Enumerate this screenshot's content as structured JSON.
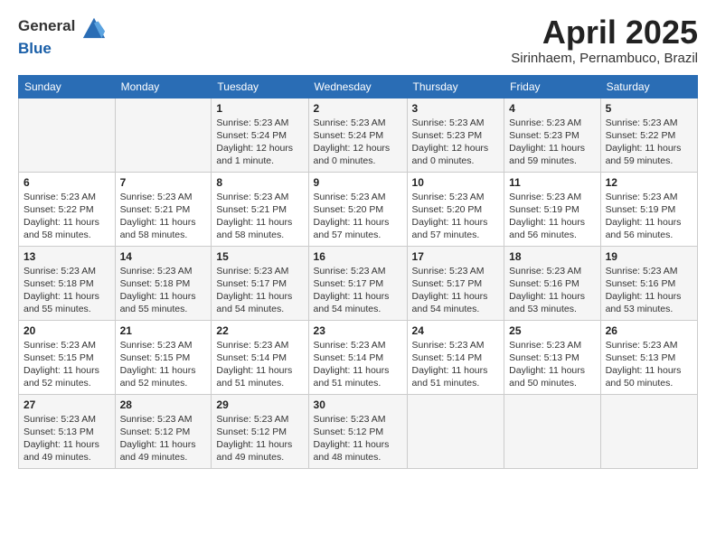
{
  "header": {
    "logo_line1": "General",
    "logo_line2": "Blue",
    "title": "April 2025",
    "subtitle": "Sirinhaem, Pernambuco, Brazil"
  },
  "days_of_week": [
    "Sunday",
    "Monday",
    "Tuesday",
    "Wednesday",
    "Thursday",
    "Friday",
    "Saturday"
  ],
  "weeks": [
    [
      {
        "day": "",
        "info": ""
      },
      {
        "day": "",
        "info": ""
      },
      {
        "day": "1",
        "info": "Sunrise: 5:23 AM\nSunset: 5:24 PM\nDaylight: 12 hours\nand 1 minute."
      },
      {
        "day": "2",
        "info": "Sunrise: 5:23 AM\nSunset: 5:24 PM\nDaylight: 12 hours\nand 0 minutes."
      },
      {
        "day": "3",
        "info": "Sunrise: 5:23 AM\nSunset: 5:23 PM\nDaylight: 12 hours\nand 0 minutes."
      },
      {
        "day": "4",
        "info": "Sunrise: 5:23 AM\nSunset: 5:23 PM\nDaylight: 11 hours\nand 59 minutes."
      },
      {
        "day": "5",
        "info": "Sunrise: 5:23 AM\nSunset: 5:22 PM\nDaylight: 11 hours\nand 59 minutes."
      }
    ],
    [
      {
        "day": "6",
        "info": "Sunrise: 5:23 AM\nSunset: 5:22 PM\nDaylight: 11 hours\nand 58 minutes."
      },
      {
        "day": "7",
        "info": "Sunrise: 5:23 AM\nSunset: 5:21 PM\nDaylight: 11 hours\nand 58 minutes."
      },
      {
        "day": "8",
        "info": "Sunrise: 5:23 AM\nSunset: 5:21 PM\nDaylight: 11 hours\nand 58 minutes."
      },
      {
        "day": "9",
        "info": "Sunrise: 5:23 AM\nSunset: 5:20 PM\nDaylight: 11 hours\nand 57 minutes."
      },
      {
        "day": "10",
        "info": "Sunrise: 5:23 AM\nSunset: 5:20 PM\nDaylight: 11 hours\nand 57 minutes."
      },
      {
        "day": "11",
        "info": "Sunrise: 5:23 AM\nSunset: 5:19 PM\nDaylight: 11 hours\nand 56 minutes."
      },
      {
        "day": "12",
        "info": "Sunrise: 5:23 AM\nSunset: 5:19 PM\nDaylight: 11 hours\nand 56 minutes."
      }
    ],
    [
      {
        "day": "13",
        "info": "Sunrise: 5:23 AM\nSunset: 5:18 PM\nDaylight: 11 hours\nand 55 minutes."
      },
      {
        "day": "14",
        "info": "Sunrise: 5:23 AM\nSunset: 5:18 PM\nDaylight: 11 hours\nand 55 minutes."
      },
      {
        "day": "15",
        "info": "Sunrise: 5:23 AM\nSunset: 5:17 PM\nDaylight: 11 hours\nand 54 minutes."
      },
      {
        "day": "16",
        "info": "Sunrise: 5:23 AM\nSunset: 5:17 PM\nDaylight: 11 hours\nand 54 minutes."
      },
      {
        "day": "17",
        "info": "Sunrise: 5:23 AM\nSunset: 5:17 PM\nDaylight: 11 hours\nand 54 minutes."
      },
      {
        "day": "18",
        "info": "Sunrise: 5:23 AM\nSunset: 5:16 PM\nDaylight: 11 hours\nand 53 minutes."
      },
      {
        "day": "19",
        "info": "Sunrise: 5:23 AM\nSunset: 5:16 PM\nDaylight: 11 hours\nand 53 minutes."
      }
    ],
    [
      {
        "day": "20",
        "info": "Sunrise: 5:23 AM\nSunset: 5:15 PM\nDaylight: 11 hours\nand 52 minutes."
      },
      {
        "day": "21",
        "info": "Sunrise: 5:23 AM\nSunset: 5:15 PM\nDaylight: 11 hours\nand 52 minutes."
      },
      {
        "day": "22",
        "info": "Sunrise: 5:23 AM\nSunset: 5:14 PM\nDaylight: 11 hours\nand 51 minutes."
      },
      {
        "day": "23",
        "info": "Sunrise: 5:23 AM\nSunset: 5:14 PM\nDaylight: 11 hours\nand 51 minutes."
      },
      {
        "day": "24",
        "info": "Sunrise: 5:23 AM\nSunset: 5:14 PM\nDaylight: 11 hours\nand 51 minutes."
      },
      {
        "day": "25",
        "info": "Sunrise: 5:23 AM\nSunset: 5:13 PM\nDaylight: 11 hours\nand 50 minutes."
      },
      {
        "day": "26",
        "info": "Sunrise: 5:23 AM\nSunset: 5:13 PM\nDaylight: 11 hours\nand 50 minutes."
      }
    ],
    [
      {
        "day": "27",
        "info": "Sunrise: 5:23 AM\nSunset: 5:13 PM\nDaylight: 11 hours\nand 49 minutes."
      },
      {
        "day": "28",
        "info": "Sunrise: 5:23 AM\nSunset: 5:12 PM\nDaylight: 11 hours\nand 49 minutes."
      },
      {
        "day": "29",
        "info": "Sunrise: 5:23 AM\nSunset: 5:12 PM\nDaylight: 11 hours\nand 49 minutes."
      },
      {
        "day": "30",
        "info": "Sunrise: 5:23 AM\nSunset: 5:12 PM\nDaylight: 11 hours\nand 48 minutes."
      },
      {
        "day": "",
        "info": ""
      },
      {
        "day": "",
        "info": ""
      },
      {
        "day": "",
        "info": ""
      }
    ]
  ]
}
